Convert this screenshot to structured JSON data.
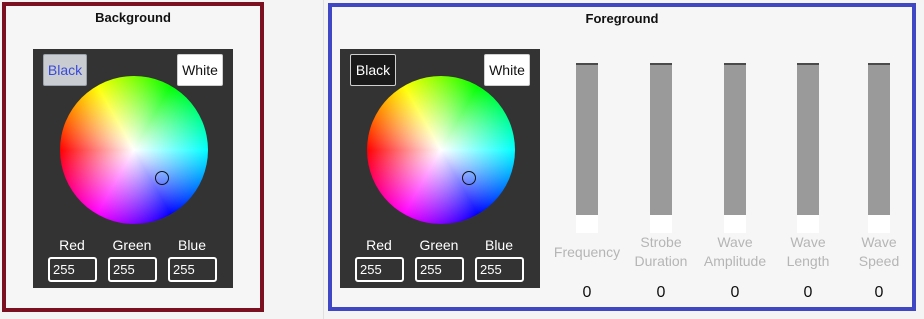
{
  "background": {
    "title": "Background",
    "black_label": "Black",
    "white_label": "White",
    "channels": [
      {
        "label": "Red",
        "value": "255"
      },
      {
        "label": "Green",
        "value": "255"
      },
      {
        "label": "Blue",
        "value": "255"
      }
    ],
    "active_mode": "Black"
  },
  "foreground": {
    "title": "Foreground",
    "black_label": "Black",
    "white_label": "White",
    "channels": [
      {
        "label": "Red",
        "value": "255"
      },
      {
        "label": "Green",
        "value": "255"
      },
      {
        "label": "Blue",
        "value": "255"
      }
    ],
    "sliders": [
      {
        "label_line1": "Frequency",
        "label_line2": "",
        "value": "0",
        "level": 0
      },
      {
        "label_line1": "Strobe",
        "label_line2": "Duration",
        "value": "0",
        "level": 0
      },
      {
        "label_line1": "Wave",
        "label_line2": "Amplitude",
        "value": "0",
        "level": 0
      },
      {
        "label_line1": "Wave",
        "label_line2": "Length",
        "value": "0",
        "level": 0
      },
      {
        "label_line1": "Wave",
        "label_line2": "Speed",
        "value": "0",
        "level": 0
      }
    ]
  },
  "colors": {
    "background_border": "#7a1020",
    "foreground_border": "#3f47c4",
    "picker_bg": "#333333"
  },
  "icons": [
    "color-wheel-icon"
  ]
}
